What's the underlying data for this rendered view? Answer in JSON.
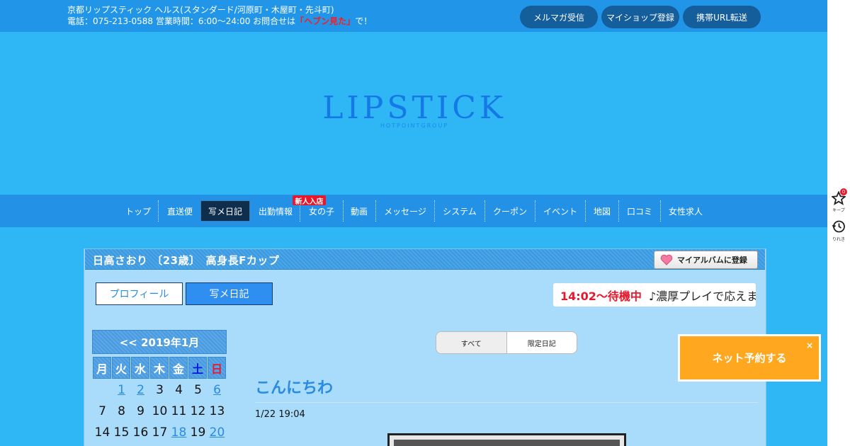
{
  "header": {
    "info_line1": "京都リップスティック ヘルス(スタンダード/河原町・木屋町・先斗町)",
    "info_line2_prefix": "電話：075-213-0588 営業時間：6:00～24:00 お問合せは",
    "info_line2_highlight": "「ヘブン見た」",
    "info_line2_suffix": "で！",
    "buttons": [
      "メルマガ受信",
      "マイショップ登録",
      "携帯URL転送"
    ]
  },
  "logo": {
    "main": "LIPSTICK",
    "sub": "HOTPOINTGROUP"
  },
  "nav": {
    "items": [
      "トップ",
      "直送便",
      "写メ日記",
      "出勤情報",
      "女の子",
      "動画",
      "メッセージ",
      "システム",
      "クーポン",
      "イベント",
      "地図",
      "口コミ",
      "女性求人"
    ],
    "active": "写メ日記",
    "badge": "新人入店"
  },
  "rail": {
    "keep_label": "キープ",
    "keep_count": "0",
    "history_label": "りれき"
  },
  "profile": {
    "title": "日高さおり 〔23歳〕　高身長Fカップ",
    "album_button": "マイアルバムに登録",
    "tabs": [
      "プロフィール",
      "写メ日記"
    ],
    "ticker_time": "14:02～待機中",
    "ticker_msg": "♪濃厚プレイで応えます"
  },
  "calendar": {
    "month_label": "<< 2019年1月",
    "weekdays": [
      "月",
      "火",
      "水",
      "木",
      "金",
      "土",
      "日"
    ],
    "rows": [
      [
        "",
        "1",
        "2",
        "3",
        "4",
        "5",
        "6"
      ],
      [
        "7",
        "8",
        "9",
        "10",
        "11",
        "12",
        "13"
      ],
      [
        "14",
        "15",
        "16",
        "17",
        "18",
        "19",
        "20"
      ]
    ],
    "linked_days": [
      "1",
      "2",
      "6",
      "18",
      "20"
    ]
  },
  "filter": {
    "options": [
      "すべて",
      "限定日記"
    ]
  },
  "post": {
    "title": "こんにちわ",
    "date": "1/22 19:04"
  },
  "reserve": {
    "label": "ネット予約する",
    "close": "×"
  },
  "colors": {
    "accent": "#2fb6f5",
    "nav": "#2392e6",
    "reserve": "#ffa81f",
    "highlight": "#e8182c"
  }
}
